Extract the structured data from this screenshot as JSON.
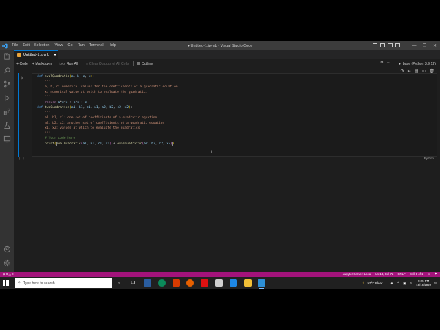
{
  "titlebar": {
    "menu": [
      "File",
      "Edit",
      "Selection",
      "View",
      "Go",
      "Run",
      "Terminal",
      "Help"
    ],
    "window_title": "● Untitled-1.ipynb - Visual Studio Code"
  },
  "tab": {
    "label": "Untitled-1.ipynb",
    "modified_dot": "●"
  },
  "toolbar": {
    "code_label": "+ Code",
    "markdown_label": "+ Markdown",
    "run_all_label": "Run All",
    "clear_outputs_label": "Clear Outputs of All Cells",
    "outline_label": "Outline",
    "kernel_label": "base (Python 3.9.12)"
  },
  "cell": {
    "language": "Python",
    "exec_count": "[ ]",
    "lines": [
      "def evalQuadratic(a, b, c, x):",
      "    '''",
      "    a, b, c: numerical values for the coefficients of a quadratic equation",
      "    x: numerical value at which to evaluate the quadratic.",
      "    '''",
      "    return a*x*x + b*x + c",
      "def twoQuadratics(a1, b1, c1, x1, a2, b2, c2, x2):",
      "    '''",
      "    a1, b1, c1: one set of coefficients of a quadratic equation",
      "    a2, b2, c2: another set of coefficients of a quadratic equation",
      "    x1, x2: values at which to evaluate the quadratics",
      "    '''",
      "    # Your code here",
      "    print(evalQuadratic(a1, b1, c1, x1) + evalQuadratic(a2, b2, c2, x2))"
    ]
  },
  "statusbar": {
    "problems": "⊗ 0 △ 0",
    "jupyter": "Jupyter Server: Local",
    "position": "Ln 14, Col 72",
    "eol": "CRLF",
    "cell_info": "Cell 1 of 1"
  },
  "taskbar": {
    "search_placeholder": "Type here to search",
    "weather": "57°F Clear",
    "time": "9:25 PM",
    "date": "10/10/2022"
  },
  "colors": {
    "accent": "#0078d4",
    "statusbar": "#a3137b",
    "activitybar": "#333333",
    "editor_bg": "#1e1e1e"
  },
  "icons": [
    "vscode-logo-icon",
    "explorer-icon",
    "search-icon",
    "source-control-icon",
    "run-debug-icon",
    "extensions-icon",
    "testing-icon",
    "remote-icon",
    "accounts-icon",
    "manage-gear-icon",
    "run-cell-icon",
    "windows-start-icon",
    "task-view-icon",
    "edge-icon",
    "firefox-icon",
    "vscode-taskbar-icon",
    "notification-icon"
  ]
}
